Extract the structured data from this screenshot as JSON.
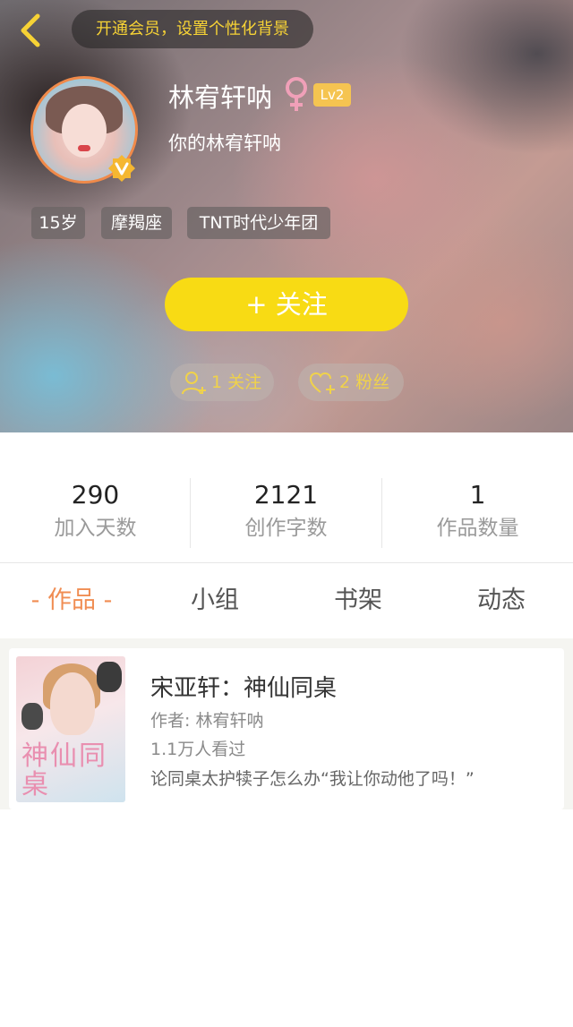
{
  "header": {
    "vip_text": "开通会员，设置个性化背景",
    "username": "林宥轩呐",
    "level": "Lv2",
    "signature": "你的林宥轩呐",
    "tags": [
      "15岁",
      "摩羯座",
      "TNT时代少年团"
    ],
    "follow_button": "+  关注",
    "following_count": "1 关注",
    "fans_count": "2 粉丝"
  },
  "stats": [
    {
      "value": "290",
      "label": "加入天数"
    },
    {
      "value": "2121",
      "label": "创作字数"
    },
    {
      "value": "1",
      "label": "作品数量"
    }
  ],
  "tabs": [
    "- 作品 -",
    "小组",
    "书架",
    "动态"
  ],
  "works": [
    {
      "title": "宋亚轩：神仙同桌",
      "author": "作者: 林宥轩呐",
      "views": "1.1万人看过",
      "description": "论同桌太护犊子怎么办“我让你动他了吗！”",
      "cover_text": "神仙同桌"
    }
  ],
  "colors": {
    "accent": "#f08d53",
    "follow_yellow": "#f8db14",
    "vip_text": "#f6d235",
    "level_badge": "#f5c451",
    "gender_pink": "#f0a0b8"
  }
}
